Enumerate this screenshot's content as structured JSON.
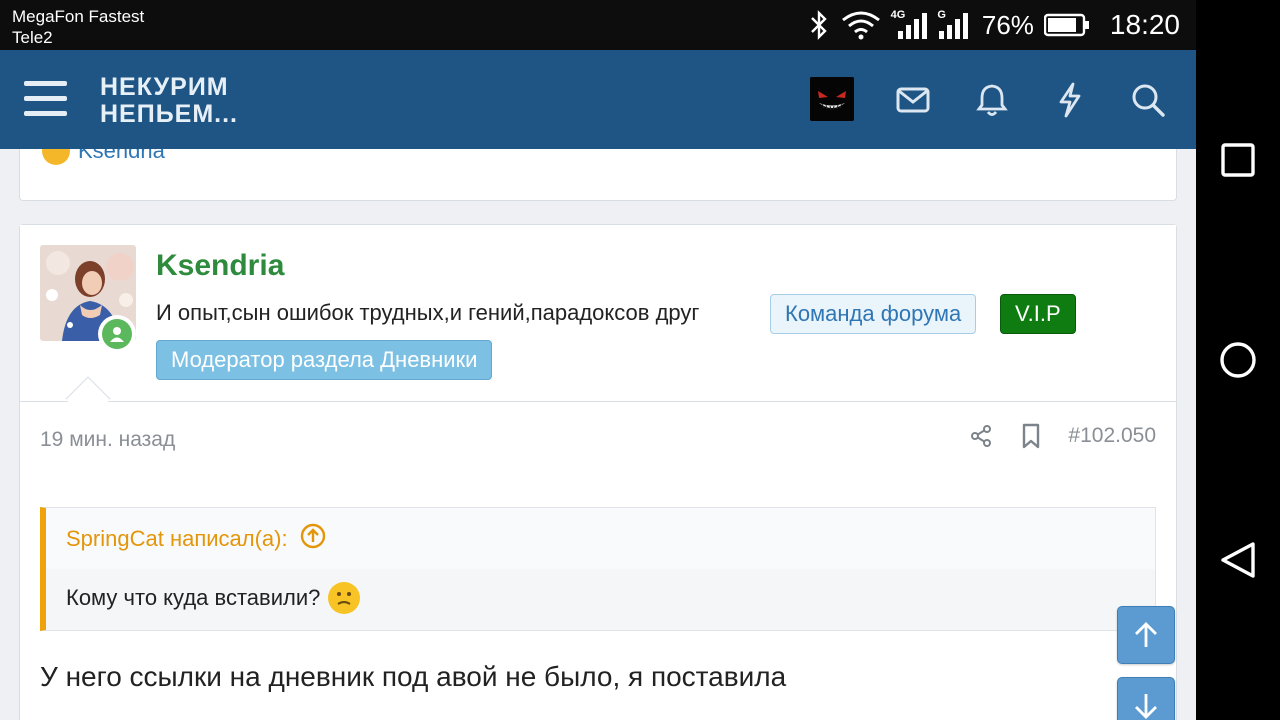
{
  "status_bar": {
    "carrier_primary": "MegaFon Fastest",
    "carrier_secondary": "Tele2",
    "network1": "4G",
    "network2": "G",
    "battery": "76%",
    "time": "18:20"
  },
  "header": {
    "logo_line1": "НЕКУРИМ",
    "logo_line2": "НЕПЬЕМ...",
    "icons": [
      "menu-icon",
      "avatar",
      "mail-icon",
      "bell-icon",
      "lightning-icon",
      "search-icon"
    ]
  },
  "previous_post": {
    "reaction_user": "Ksendria"
  },
  "post": {
    "username": "Ksendria",
    "user_title": "И опыт,сын ошибок трудных,и гений,парадоксов друг",
    "badges": {
      "team": "Команда форума",
      "vip": "V.I.P",
      "moderator": "Модератор раздела Дневники"
    },
    "time": "19 мин. назад",
    "post_number": "#102.050",
    "quote": {
      "author_line": "SpringCat написал(а):",
      "text": "Кому что куда вставили?"
    },
    "text": "У него ссылки на дневник под авой не было, я поставила"
  },
  "colors": {
    "header_bg": "#1e5585",
    "username": "#2e8b3d",
    "quote_accent": "#f0a20c",
    "vip_badge": "#0f7c11",
    "moderator_badge": "#7cc0e3",
    "scroll_button": "#5c9bd1"
  }
}
